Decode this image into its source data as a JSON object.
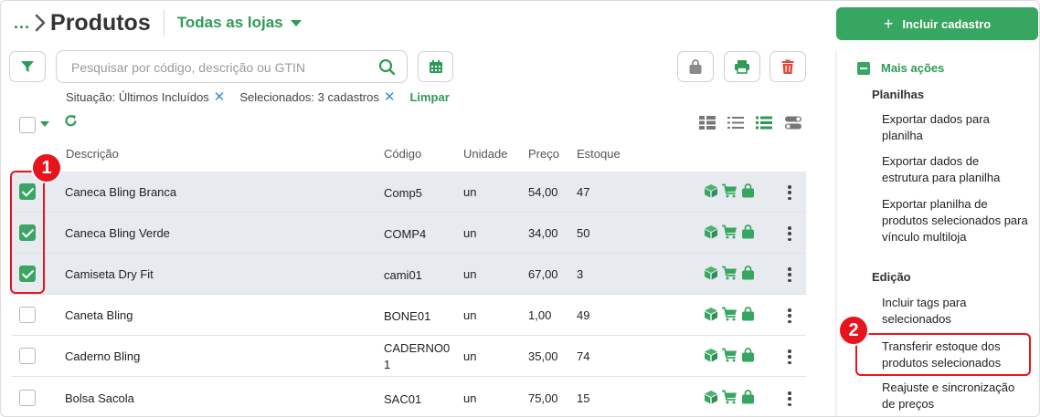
{
  "header": {
    "breadcrumb_dots": "...",
    "title": "Produtos",
    "store_select": "Todas as lojas"
  },
  "search": {
    "placeholder": "Pesquisar por código, descrição ou GTIN"
  },
  "filters": {
    "situation": "Situação: Últimos Incluídos",
    "selected": "Selecionados: 3 cadastros",
    "remove_symbol": "✕",
    "clear": "Limpar"
  },
  "table": {
    "columns": {
      "description": "Descrição",
      "code": "Código",
      "unit": "Unidade",
      "price": "Preço",
      "stock": "Estoque"
    },
    "rows": [
      {
        "selected": true,
        "description": "Caneca Bling Branca",
        "code": "Comp5",
        "unit": "un",
        "price": "54,00",
        "stock": "47"
      },
      {
        "selected": true,
        "description": "Caneca Bling Verde",
        "code": "COMP4",
        "unit": "un",
        "price": "34,00",
        "stock": "50"
      },
      {
        "selected": true,
        "description": "Camiseta Dry Fit",
        "code": "cami01",
        "unit": "un",
        "price": "67,00",
        "stock": "3"
      },
      {
        "selected": false,
        "description": "Caneta Bling",
        "code": "BONE01",
        "unit": "un",
        "price": "1,00",
        "stock": "49"
      },
      {
        "selected": false,
        "description": "Caderno Bling",
        "code": "CADERNO0\n1",
        "unit": "un",
        "price": "35,00",
        "stock": "74"
      },
      {
        "selected": false,
        "description": "Bolsa Sacola",
        "code": "SAC01",
        "unit": "un",
        "price": "75,00",
        "stock": "15"
      }
    ],
    "row_icons": [
      "box-icon",
      "cart-icon",
      "bag-icon"
    ]
  },
  "annotations": {
    "callout_1": "1",
    "callout_2": "2"
  },
  "side_panel": {
    "add_button": "Incluir cadastro",
    "add_symbol": "+",
    "more_actions": "Mais ações",
    "sections": [
      {
        "title": "Planilhas",
        "items": [
          "Exportar dados para planilha",
          "Exportar dados de estrutura para planilha",
          "Exportar planilha de produtos selecionados para vínculo multiloja"
        ]
      },
      {
        "title": "Edição",
        "items": [
          "Incluir tags para selecionados",
          "Transferir estoque dos produtos selecionados",
          "Reajuste e sincronização de preços"
        ]
      }
    ]
  },
  "colors": {
    "accent": "#36a660",
    "annotation": "#e8141d",
    "selected_row": "#e7eaef",
    "delete": "#e04a3b"
  }
}
